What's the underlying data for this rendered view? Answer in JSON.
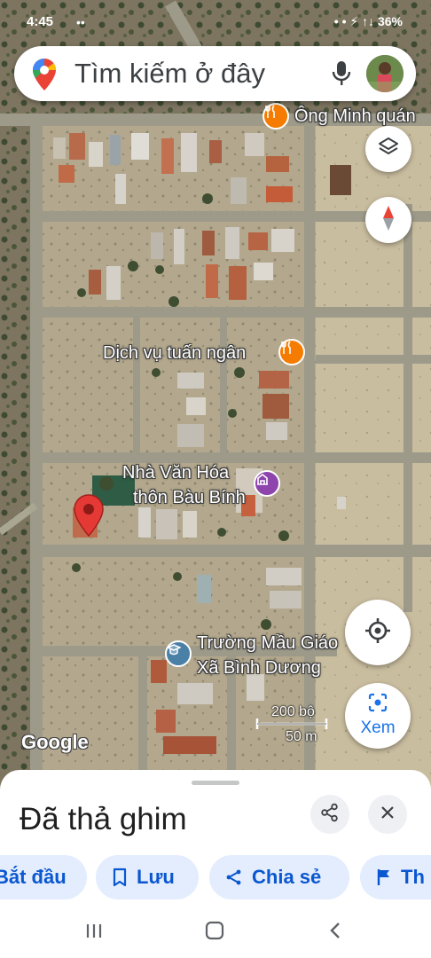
{
  "status_bar": {
    "time": "4:45",
    "indicators": "••",
    "right_text": "• • ⚡ ↑↓ 36%"
  },
  "search": {
    "placeholder": "Tìm kiếm ở đây",
    "logo_icon": "google-maps-pin-icon",
    "mic_icon": "microphone-icon",
    "avatar_icon": "user-avatar"
  },
  "map": {
    "labels": {
      "restaurant_top": "Ông Minh quán",
      "restaurant_mid": "Dịch vụ tuấn ngân",
      "cultural_house_line1": "Nhà Văn Hóa",
      "cultural_house_line2": "thôn Bàu Bính",
      "school_line1": "Trường Mầu Giáo",
      "school_line2": "Xã Bình Dương"
    },
    "scale": {
      "top": "200 bộ",
      "bottom": "50 m"
    },
    "attribution": "Google",
    "colors": {
      "road": "#9b9a8c",
      "land": "#a59a80",
      "restaurant_pin": "#f57c00",
      "community_pin": "#8e44ad",
      "school_pin": "#4a7fa6",
      "dropped_pin": "#e53935"
    }
  },
  "controls": {
    "layers_icon": "layers-icon",
    "compass_icon": "compass-icon",
    "my_location_icon": "my-location-icon",
    "explore_label": "Xem"
  },
  "sheet": {
    "title": "Đã thả ghim",
    "share_icon": "share-icon",
    "close_icon": "close-icon",
    "chips": [
      {
        "label": "Bắt đầu",
        "icon": "navigation-icon"
      },
      {
        "label": "Lưu",
        "icon": "bookmark-icon"
      },
      {
        "label": "Chia sẻ",
        "icon": "share-icon"
      },
      {
        "label": "Th",
        "icon": "flag-icon"
      }
    ],
    "accent": "#0b57d0",
    "chip_bg": "#e3edfd"
  },
  "nav": {
    "recents_icon": "recents-icon",
    "home_icon": "home-icon",
    "back_icon": "back-icon"
  }
}
